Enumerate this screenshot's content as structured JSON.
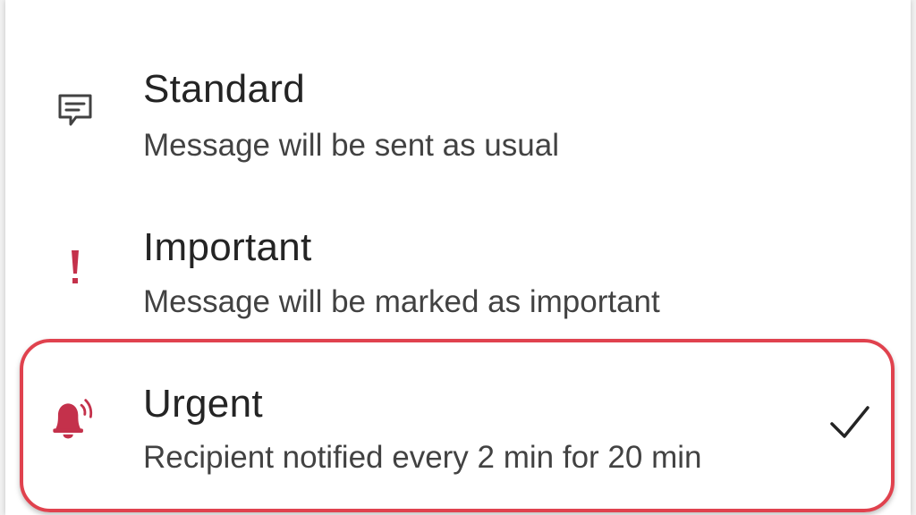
{
  "priority_menu": {
    "options": [
      {
        "title": "Standard",
        "description": "Message will be sent as usual",
        "icon": "message-icon"
      },
      {
        "title": "Important",
        "description": "Message will be marked as important",
        "icon": "exclamation-icon"
      },
      {
        "title": "Urgent",
        "description": "Recipient notified every 2 min for 20 min",
        "icon": "bell-ringing-icon",
        "selected": true
      }
    ]
  },
  "colors": {
    "important_red": "#c4314b",
    "highlight_border": "#e0424e",
    "text_primary": "#242424",
    "text_secondary": "#424242"
  }
}
